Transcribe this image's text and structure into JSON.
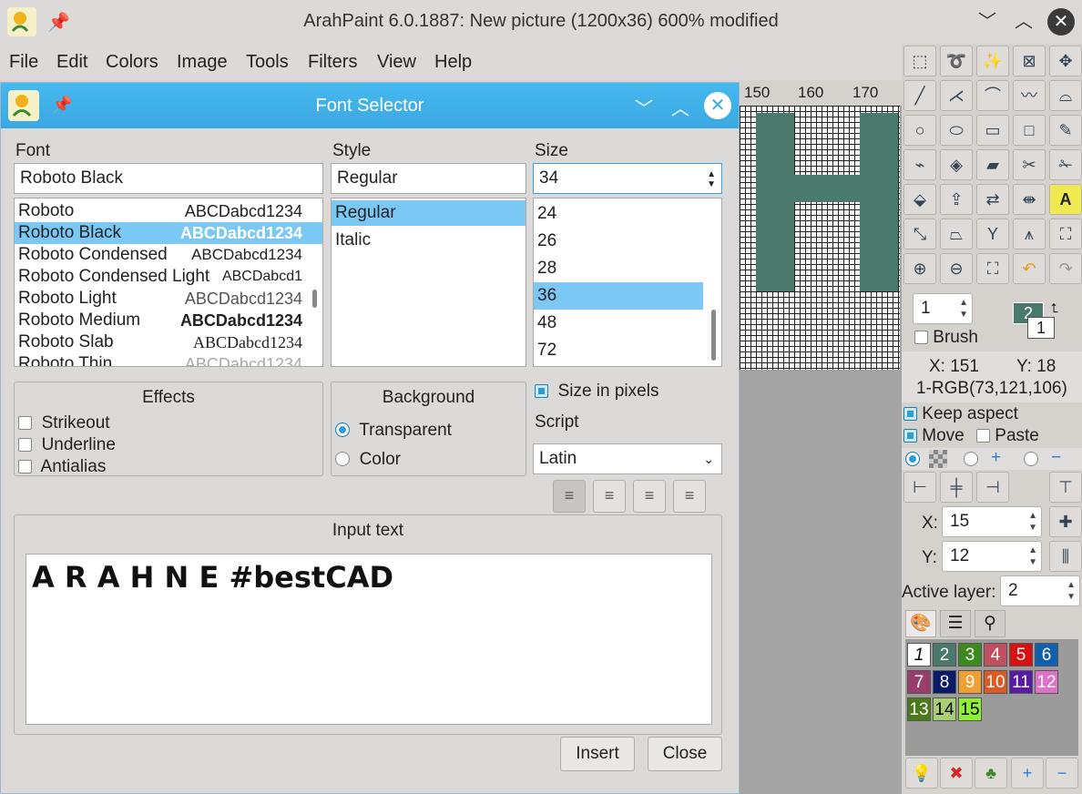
{
  "window": {
    "title": "ArahPaint 6.0.1887: New picture (1200x36) 600% modified"
  },
  "menu": [
    "File",
    "Edit",
    "Colors",
    "Image",
    "Tools",
    "Filters",
    "View",
    "Help"
  ],
  "ruler": [
    "150",
    "160",
    "170"
  ],
  "dialog": {
    "title": "Font Selector",
    "font_label": "Font",
    "font_value": "Roboto Black",
    "fonts": [
      {
        "name": "Roboto",
        "preview": "ABCDabcd1234"
      },
      {
        "name": "Roboto Black",
        "preview": "ABCDabcd1234"
      },
      {
        "name": "Roboto Condensed",
        "preview": "ABCDabcd1234"
      },
      {
        "name": "Roboto Condensed Light",
        "preview": "ABCDabcd1"
      },
      {
        "name": "Roboto Light",
        "preview": "ABCDabcd1234"
      },
      {
        "name": "Roboto Medium",
        "preview": "ABCDabcd1234"
      },
      {
        "name": "Roboto Slab",
        "preview": "ABCDabcd1234"
      },
      {
        "name": "Roboto Thin",
        "preview": "ABCDabcd1234"
      }
    ],
    "style_label": "Style",
    "style_value": "Regular",
    "styles": [
      "Regular",
      "Italic"
    ],
    "size_label": "Size",
    "size_value": "34",
    "sizes": [
      "24",
      "26",
      "28",
      "36",
      "48",
      "72"
    ],
    "effects": {
      "title": "Effects",
      "items": [
        "Strikeout",
        "Underline",
        "Antialias"
      ]
    },
    "background": {
      "title": "Background",
      "options": [
        "Transparent",
        "Color"
      ]
    },
    "size_in_pixels": "Size in pixels",
    "script_label": "Script",
    "script_value": "Latin",
    "input_label": "Input text",
    "input_text": "A R A H N E #bestCAD",
    "insert": "Insert",
    "close": "Close"
  },
  "panel": {
    "brush_size": "1",
    "brush_label": "Brush",
    "color_fg": "2",
    "color_bg": "1",
    "coord_x": "X: 151",
    "coord_y": "Y: 18",
    "rgb": "1-RGB(73,121,106)",
    "keep_aspect": "Keep aspect",
    "move": "Move",
    "paste": "Paste",
    "x_label": "X:",
    "x_value": "15",
    "y_label": "Y:",
    "y_value": "12",
    "active_layer_label": "Active layer:",
    "active_layer_value": "2"
  },
  "palette": [
    {
      "n": "1",
      "c": "#ffffff"
    },
    {
      "n": "2",
      "c": "#49796a"
    },
    {
      "n": "3",
      "c": "#3a8a1e"
    },
    {
      "n": "4",
      "c": "#c05060"
    },
    {
      "n": "5",
      "c": "#d81010"
    },
    {
      "n": "6",
      "c": "#1060b0"
    },
    {
      "n": "7",
      "c": "#9a3c6c"
    },
    {
      "n": "8",
      "c": "#0a1a6a"
    },
    {
      "n": "9",
      "c": "#f0a030"
    },
    {
      "n": "10",
      "c": "#e05a20"
    },
    {
      "n": "11",
      "c": "#5a1aa8"
    },
    {
      "n": "12",
      "c": "#e070c8"
    },
    {
      "n": "13",
      "c": "#4a7a1a"
    },
    {
      "n": "14",
      "c": "#a8d070"
    },
    {
      "n": "15",
      "c": "#90f030"
    }
  ]
}
